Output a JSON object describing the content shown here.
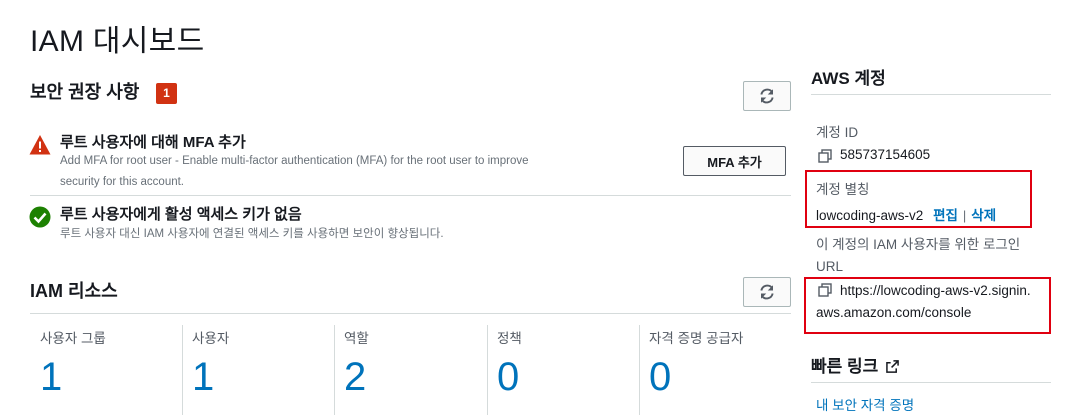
{
  "page": {
    "title": "IAM 대시보드"
  },
  "security": {
    "header": "보안 권장 사항",
    "badge_count": "1",
    "recommendations": [
      {
        "title": "루트 사용자에 대해 MFA 추가",
        "description_line1": "Add MFA for root user - Enable multi-factor authentication (MFA) for the root user to improve",
        "description_line2": "security for this account.",
        "status": "warning",
        "button_label": "MFA 추가"
      },
      {
        "title": "루트 사용자에게 활성 액세스 키가 없음",
        "description_line1": "루트 사용자 대신 IAM 사용자에 연결된 액세스 키를 사용하면 보안이 향상됩니다.",
        "status": "success"
      }
    ]
  },
  "resources": {
    "header": "IAM 리소스",
    "items": [
      {
        "label": "사용자 그룹",
        "value": "1"
      },
      {
        "label": "사용자",
        "value": "1"
      },
      {
        "label": "역할",
        "value": "2"
      },
      {
        "label": "정책",
        "value": "0"
      },
      {
        "label": "자격 증명 공급자",
        "value": "0"
      }
    ]
  },
  "account": {
    "header": "AWS 계정",
    "id_label": "계정 ID",
    "id_value": "585737154605",
    "alias_label": "계정 별칭",
    "alias_value": "lowcoding-aws-v2",
    "edit_label": "편집",
    "pipe": "|",
    "delete_label": "삭제",
    "signin_label_line1": "이 계정의 IAM 사용자를 위한 로그인",
    "signin_label_line2": "URL",
    "signin_url_line1": "https://lowcoding-aws-v2.signin.",
    "signin_url_line2": "aws.amazon.com/console"
  },
  "quick_links": {
    "header": "빠른 링크",
    "items": [
      {
        "label": "내 보안 자격 증명"
      }
    ]
  },
  "colors": {
    "link": "#0073bb",
    "badge": "#d13212",
    "success": "#1d8102",
    "highlight_box": "#e00010"
  }
}
